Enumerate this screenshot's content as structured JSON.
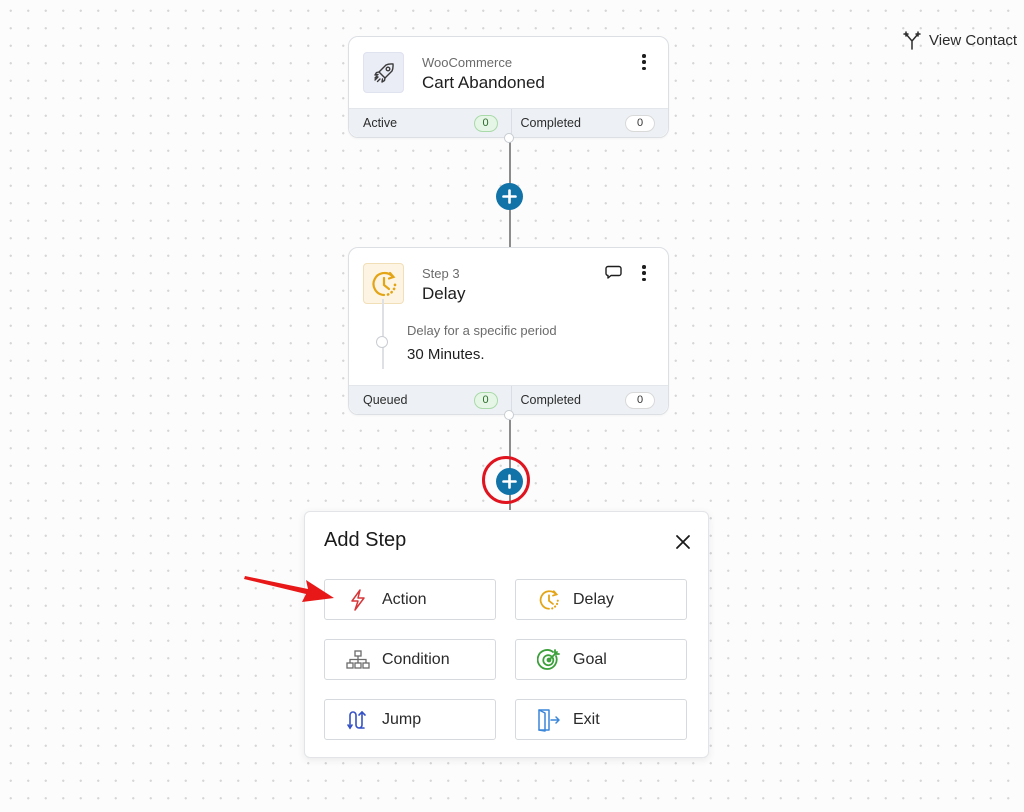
{
  "header": {
    "view_contact_label": "View Contact",
    "view_contact_icon": "branch-icon"
  },
  "trigger_card": {
    "icon": "rocket-icon",
    "subtitle": "WooCommerce",
    "title": "Cart Abandoned",
    "stats": [
      {
        "label": "Active",
        "value": "0"
      },
      {
        "label": "Completed",
        "value": "0"
      }
    ]
  },
  "delay_card": {
    "icon": "clock-icon",
    "subtitle": "Step 3",
    "title": "Delay",
    "detail_label": "Delay for a specific period",
    "detail_value": "30 Minutes.",
    "stats": [
      {
        "label": "Queued",
        "value": "0"
      },
      {
        "label": "Completed",
        "value": "0"
      }
    ]
  },
  "add_step_modal": {
    "title": "Add Step",
    "options": [
      {
        "label": "Action",
        "icon": "lightning-icon",
        "color": "#d63638"
      },
      {
        "label": "Delay",
        "icon": "clock-icon",
        "color": "#e3a416"
      },
      {
        "label": "Condition",
        "icon": "sitemap-icon",
        "color": "#6b6b6b"
      },
      {
        "label": "Goal",
        "icon": "target-icon",
        "color": "#3ba03b"
      },
      {
        "label": "Jump",
        "icon": "jump-icon",
        "color": "#3451c6"
      },
      {
        "label": "Exit",
        "icon": "exit-door-icon",
        "color": "#3a86d8"
      }
    ]
  },
  "colors": {
    "add_button": "#1173a8",
    "annotation_red": "#e0141e"
  }
}
